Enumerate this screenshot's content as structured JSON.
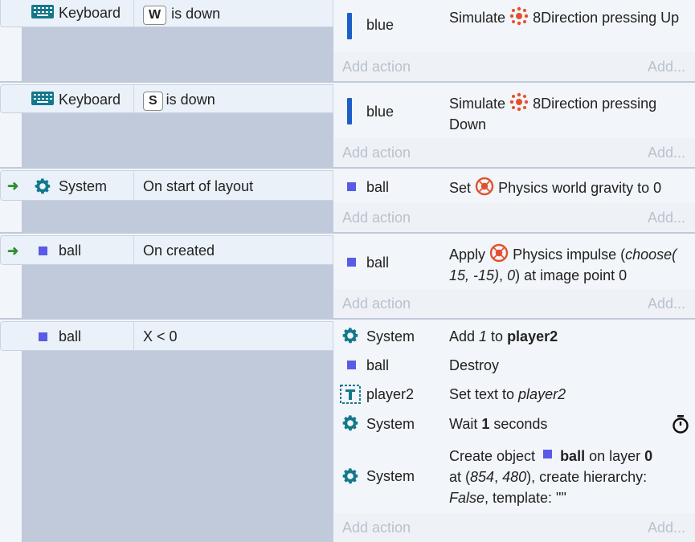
{
  "events": [
    {
      "condition": {
        "object": "Keyboard",
        "key": "W",
        "text": "is down"
      },
      "actions": [
        {
          "object": "blue",
          "text1": "Simulate",
          "text2": "8Direction pressing Up"
        }
      ],
      "add_action": "Add action",
      "add_more": "Add..."
    },
    {
      "condition": {
        "object": "Keyboard",
        "key": "S",
        "text": "is down"
      },
      "actions": [
        {
          "object": "blue",
          "text1": "Simulate",
          "text2": "8Direction pressing Down"
        }
      ],
      "add_action": "Add action",
      "add_more": "Add..."
    },
    {
      "condition": {
        "object": "System",
        "text": "On start of layout"
      },
      "actions": [
        {
          "object": "ball",
          "text1": "Set",
          "text2": "Physics world gravity to 0"
        }
      ],
      "add_action": "Add action",
      "add_more": "Add..."
    },
    {
      "condition": {
        "object": "ball",
        "text": "On created"
      },
      "actions": [
        {
          "object": "ball",
          "text1": "Apply",
          "text2": "Physics impulse (",
          "italic1": "choose( 15, -15)",
          "text3": ", ",
          "italic2": "0",
          "text4": ") at image point 0"
        }
      ],
      "add_action": "Add action",
      "add_more": "Add..."
    },
    {
      "condition": {
        "object": "ball",
        "text": "X < 0"
      },
      "actions": [
        {
          "object": "System",
          "text1": "Add ",
          "italic1": "1",
          "text2": " to ",
          "bold1": "player2"
        },
        {
          "object": "ball",
          "text1": "Destroy"
        },
        {
          "object": "player2",
          "text1": "Set text to ",
          "italic1": "player2"
        },
        {
          "object": "System",
          "text1": "Wait ",
          "bold1": "1",
          "text2": " seconds"
        },
        {
          "object": "System",
          "text1": "Create object",
          "bold1": "ball",
          "text2": " on layer ",
          "bold2": "0",
          "text3": "at (",
          "italic1": "854",
          "text4": ", ",
          "italic2": "480",
          "text5": "), create hierarchy:",
          "italic3": "False",
          "text6": ", template: \"\""
        }
      ],
      "add_action": "Add action",
      "add_more": "Add..."
    }
  ],
  "colors": {
    "accent": "#14788c",
    "blue": "#1d5fc8",
    "ball": "#5a5ae6",
    "arrow": "#2f8f2f",
    "physics": "#e2512c"
  }
}
